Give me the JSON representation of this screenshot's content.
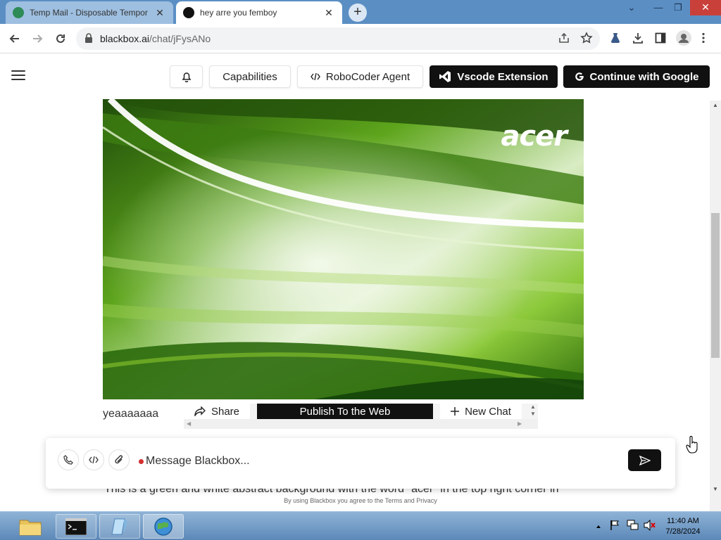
{
  "browser": {
    "tabs": [
      {
        "title": "Temp Mail - Disposable Tempor",
        "favicon_color": "#2e8b57",
        "active": false
      },
      {
        "title": "hey arre you femboy",
        "favicon_color": "#111111",
        "active": true
      }
    ],
    "url_host": "blackbox.ai",
    "url_path": "/chat/jFysANo"
  },
  "header": {
    "buttons": {
      "capabilities": "Capabilities",
      "robocoder": "RoboCoder Agent",
      "vscode": "Vscode Extension",
      "google": "Continue with Google"
    }
  },
  "chat": {
    "image_brand": "acer",
    "reply_text": "yeaaaaaaa",
    "actions": {
      "share": "Share",
      "publish": "Publish To the Web",
      "new_chat": "New Chat"
    },
    "description_text": "This is a green and white abstract background with the word \"acer\" in the top right corner in",
    "composer_placeholder": "Message Blackbox...",
    "terms_text": "By using Blackbox you agree to the Terms and Privacy"
  },
  "taskbar": {
    "time": "11:40 AM",
    "date": "7/28/2024"
  },
  "colors": {
    "titlebar": "#5b8fc4",
    "accent_dark": "#111111",
    "recording_dot": "#d32f2f",
    "hero_green": "#6cb520"
  },
  "icons": [
    "back-icon",
    "forward-icon",
    "reload-icon",
    "lock-icon",
    "share-page-icon",
    "star-icon",
    "extension-icon",
    "download-icon",
    "sidebar-icon",
    "profile-icon",
    "more-icon",
    "bell-icon",
    "code-icon",
    "vscode-icon",
    "google-icon",
    "share-icon",
    "plus-icon",
    "phone-icon",
    "attach-icon",
    "send-icon"
  ]
}
